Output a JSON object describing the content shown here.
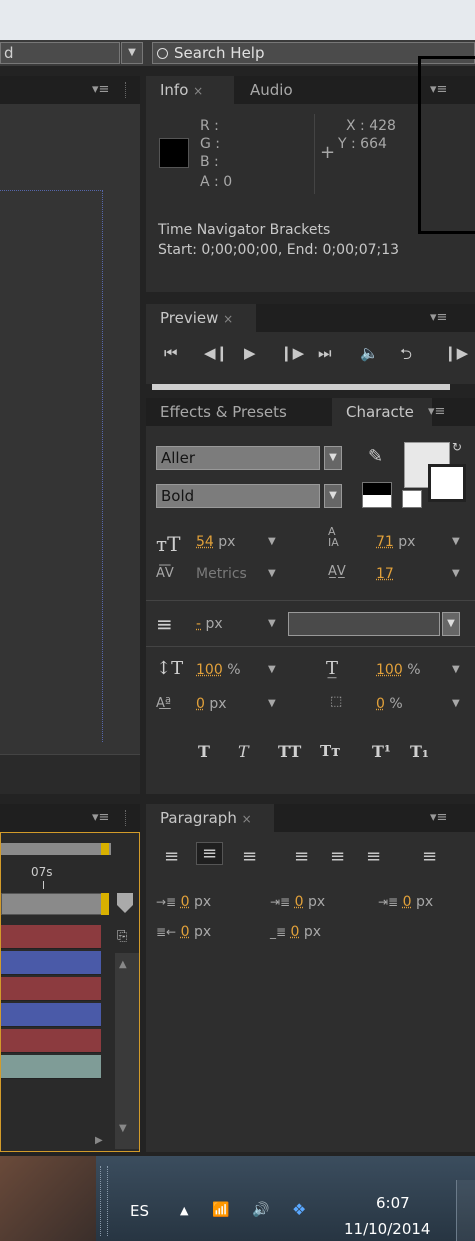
{
  "topbar": {
    "workspace_value": "d",
    "search_placeholder": "Search Help"
  },
  "info": {
    "tab_info": "Info",
    "tab_audio": "Audio",
    "r": "R :",
    "g": "G :",
    "b": "B :",
    "a": "A : 0",
    "x": "X : 428",
    "y": "Y : 664",
    "plus": "+",
    "bracket_title": "Time Navigator Brackets",
    "bracket_range": "Start: 0;00;00;00, End: 0;00;07;13",
    "swatch_color": "#000000"
  },
  "preview": {
    "tab": "Preview"
  },
  "character": {
    "tab_effects": "Effects & Presets",
    "tab_character": "Characte",
    "font_family": "Aller",
    "font_style": "Bold",
    "font_size_value": "54",
    "font_size_unit": "px",
    "leading_value": "71",
    "leading_unit": "px",
    "kerning_value": "Metrics",
    "tracking_value": "17",
    "stroke_value": "-",
    "stroke_unit": "px",
    "vscale_value": "100",
    "vscale_unit": "%",
    "hscale_value": "100",
    "hscale_unit": "%",
    "baseline_value": "0",
    "baseline_unit": "px",
    "tsume_value": "0",
    "tsume_unit": "%",
    "style_buttons": [
      "T",
      "T",
      "TT",
      "Tт",
      "T¹",
      "T₁"
    ]
  },
  "timeline": {
    "time_label": "07s",
    "tracks": [
      {
        "color": "#8c3b3f"
      },
      {
        "color": "#4a5aa8"
      },
      {
        "color": "#8c3b3f"
      },
      {
        "color": "#4a5aa8"
      },
      {
        "color": "#8c3b3f"
      },
      {
        "color": "#7f9c97"
      }
    ]
  },
  "paragraph": {
    "tab": "Paragraph",
    "indent_left": "0",
    "indent_right": "0",
    "first_line": "0",
    "space_before": "0",
    "space_after": "0",
    "unit": "px"
  },
  "taskbar": {
    "language": "ES",
    "time": "6:07",
    "date": "11/10/2014"
  }
}
